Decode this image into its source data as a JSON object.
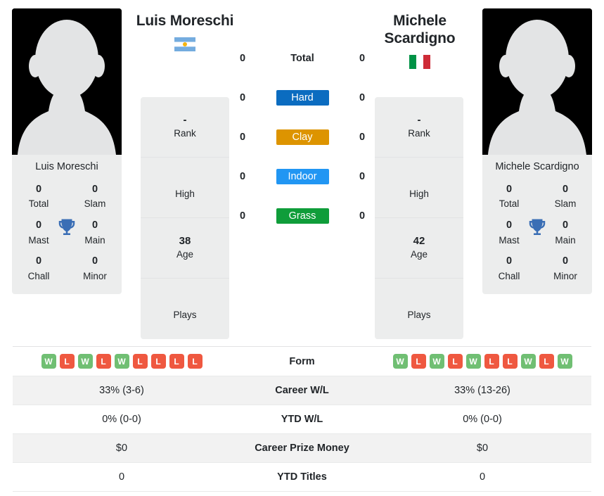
{
  "players": {
    "left": {
      "name": "Luis Moreschi",
      "card_name": "Luis Moreschi",
      "country": "Argentina",
      "flag_icon": "argentina-flag-icon",
      "avatar_icon": "player-silhouette-icon",
      "info": [
        {
          "value": "-",
          "label": "Rank"
        },
        {
          "value": "",
          "label": "High"
        },
        {
          "value": "38",
          "label": "Age"
        },
        {
          "value": "",
          "label": "Plays"
        }
      ],
      "titles": [
        {
          "value": "0",
          "label": "Total"
        },
        {
          "value": "0",
          "label": "Slam"
        },
        {
          "value": "0",
          "label": "Mast"
        },
        {
          "value": "0",
          "label": "Main"
        },
        {
          "value": "0",
          "label": "Chall"
        },
        {
          "value": "0",
          "label": "Minor"
        }
      ],
      "surface_counts": [
        "0",
        "0",
        "0",
        "0",
        "0"
      ],
      "form": [
        "W",
        "L",
        "W",
        "L",
        "W",
        "L",
        "L",
        "L",
        "L"
      ],
      "career_wl": "33% (3-6)",
      "ytd_wl": "0% (0-0)",
      "career_prize_money": "$0",
      "ytd_titles": "0"
    },
    "right": {
      "name": "Michele Scardigno",
      "card_name": "Michele Scardigno",
      "country": "Italy",
      "flag_icon": "italy-flag-icon",
      "avatar_icon": "player-silhouette-icon",
      "info": [
        {
          "value": "-",
          "label": "Rank"
        },
        {
          "value": "",
          "label": "High"
        },
        {
          "value": "42",
          "label": "Age"
        },
        {
          "value": "",
          "label": "Plays"
        }
      ],
      "titles": [
        {
          "value": "0",
          "label": "Total"
        },
        {
          "value": "0",
          "label": "Slam"
        },
        {
          "value": "0",
          "label": "Mast"
        },
        {
          "value": "0",
          "label": "Main"
        },
        {
          "value": "0",
          "label": "Chall"
        },
        {
          "value": "0",
          "label": "Minor"
        }
      ],
      "surface_counts": [
        "0",
        "0",
        "0",
        "0",
        "0"
      ],
      "form": [
        "W",
        "L",
        "W",
        "L",
        "W",
        "L",
        "L",
        "W",
        "L",
        "W"
      ],
      "career_wl": "33% (13-26)",
      "ytd_wl": "0% (0-0)",
      "career_prize_money": "$0",
      "ytd_titles": "0"
    }
  },
  "surfaces": [
    {
      "label": "Total",
      "tinted": false,
      "color": ""
    },
    {
      "label": "Hard",
      "tinted": true,
      "color": "#0b6cc0"
    },
    {
      "label": "Clay",
      "tinted": true,
      "color": "#dd9400"
    },
    {
      "label": "Indoor",
      "tinted": true,
      "color": "#2196f3"
    },
    {
      "label": "Grass",
      "tinted": true,
      "color": "#0f9d3a"
    }
  ],
  "table": {
    "rows": [
      {
        "label": "Form",
        "type": "form"
      },
      {
        "label": "Career W/L",
        "left": "33% (3-6)",
        "right": "33% (13-26)"
      },
      {
        "label": "YTD W/L",
        "left": "0% (0-0)",
        "right": "0% (0-0)"
      },
      {
        "label": "Career Prize Money",
        "left": "$0",
        "right": "$0"
      },
      {
        "label": "YTD Titles",
        "left": "0",
        "right": "0"
      }
    ]
  },
  "colors": {
    "win": "#70bf73",
    "loss": "#ef5840",
    "panel": "#eceded",
    "trophy": "#3a6eb5",
    "row_alt": "#f2f2f2"
  }
}
